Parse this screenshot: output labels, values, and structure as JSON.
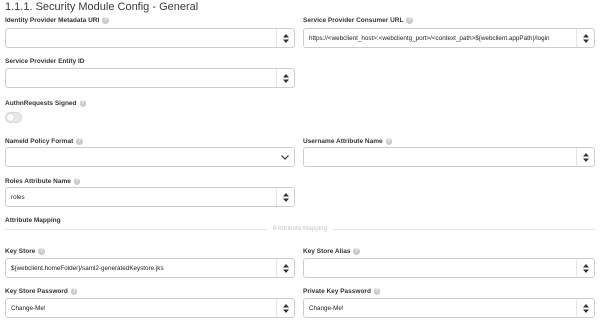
{
  "page_title": "1.1.1. Security Module Config - General",
  "fields": {
    "idp_metadata_uri": {
      "label": "Identity Provider Metadata URI",
      "value": ""
    },
    "sp_consumer_url": {
      "label": "Service Provider Consumer URL",
      "value": "https://<webclient_host>:<webclientg_port>/<context_path>${webclient.appPath}/login"
    },
    "sp_entity_id": {
      "label": "Service Provider Entity ID",
      "value": ""
    },
    "authn_requests_signed": {
      "label": "AuthnRequests Signed",
      "checked": false
    },
    "nameid_policy_format": {
      "label": "NameId Policy Format",
      "value": ""
    },
    "username_attribute_name": {
      "label": "Username Attribute Name",
      "value": ""
    },
    "roles_attribute_name": {
      "label": "Roles Attribute Name",
      "value": "roles"
    },
    "attribute_mapping": {
      "label": "Attribute Mapping",
      "summary": "6 Attribute Mapping"
    },
    "key_store": {
      "label": "Key Store",
      "value": "${webclient.homeFolder}/saml2-generatedKeystore.jks"
    },
    "key_store_alias": {
      "label": "Key Store Alias",
      "value": ""
    },
    "key_store_password": {
      "label": "Key Store Password",
      "value": "Change-Me!"
    },
    "private_key_password": {
      "label": "Private Key Password",
      "value": "Change-Me!"
    }
  },
  "icons": {
    "help": "question-circle-icon",
    "stepper": "up-down-arrows-icon",
    "dropdown": "chevron-down-icon"
  },
  "colors": {
    "border": "#c9ced6",
    "help_icon": "#c8ccd2",
    "toggle_off": "#e6e8ec",
    "muted_text": "#c3c6cb"
  }
}
